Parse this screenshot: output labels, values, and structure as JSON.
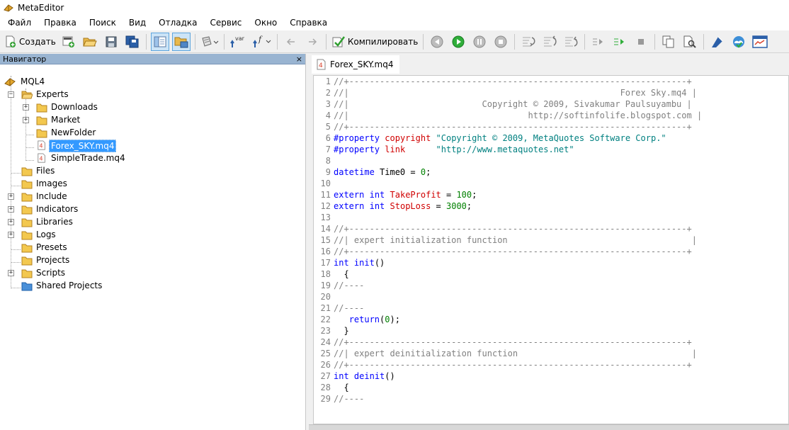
{
  "app": {
    "title": "MetaEditor"
  },
  "menu": [
    "Файл",
    "Правка",
    "Поиск",
    "Вид",
    "Отладка",
    "Сервис",
    "Окно",
    "Справка"
  ],
  "toolbar": {
    "create_label": "Создать",
    "compile_label": "Компилировать",
    "var_label": "var",
    "f_label": "f"
  },
  "navigator": {
    "title": "Навигатор",
    "close": "×",
    "root": "MQL4",
    "experts": "Experts",
    "downloads": "Downloads",
    "market": "Market",
    "newfolder": "NewFolder",
    "forex_sky": "Forex_SKY.mq4",
    "simpletrade": "SimpleTrade.mq4",
    "files": "Files",
    "images": "Images",
    "include": "Include",
    "indicators": "Indicators",
    "libraries": "Libraries",
    "logs": "Logs",
    "presets": "Presets",
    "projects": "Projects",
    "scripts": "Scripts",
    "shared_projects": "Shared Projects"
  },
  "editor": {
    "tab_label": "Forex_SKY.mq4",
    "lines": [
      [
        [
          "c-comment",
          "//+------------------------------------------------------------------+"
        ]
      ],
      [
        [
          "c-comment",
          "//|                                                     Forex Sky.mq4 |"
        ]
      ],
      [
        [
          "c-comment",
          "//|                          Copyright © 2009, Sivakumar Paulsuyambu |"
        ]
      ],
      [
        [
          "c-comment",
          "//|                                   http://softinfolife.blogspot.com |"
        ]
      ],
      [
        [
          "c-comment",
          "//+------------------------------------------------------------------+"
        ]
      ],
      [
        [
          "c-kw",
          "#property"
        ],
        [
          "",
          " "
        ],
        [
          "c-red",
          "copyright"
        ],
        [
          "",
          " "
        ],
        [
          "c-str",
          "\"Copyright © 2009, MetaQuotes Software Corp.\""
        ]
      ],
      [
        [
          "c-kw",
          "#property"
        ],
        [
          "",
          " "
        ],
        [
          "c-red",
          "link"
        ],
        [
          "",
          "      "
        ],
        [
          "c-str",
          "\"http://www.metaquotes.net\""
        ]
      ],
      [],
      [
        [
          "c-kw",
          "datetime"
        ],
        [
          "",
          " Time0 = "
        ],
        [
          "c-num",
          "0"
        ],
        [
          "",
          ";"
        ]
      ],
      [],
      [
        [
          "c-kw",
          "extern"
        ],
        [
          "",
          " "
        ],
        [
          "c-kw",
          "int"
        ],
        [
          "",
          " "
        ],
        [
          "c-red",
          "TakeProfit"
        ],
        [
          "",
          " = "
        ],
        [
          "c-num",
          "100"
        ],
        [
          "",
          ";"
        ]
      ],
      [
        [
          "c-kw",
          "extern"
        ],
        [
          "",
          " "
        ],
        [
          "c-kw",
          "int"
        ],
        [
          "",
          " "
        ],
        [
          "c-red",
          "StopLoss"
        ],
        [
          "",
          " = "
        ],
        [
          "c-num",
          "3000"
        ],
        [
          "",
          ";"
        ]
      ],
      [],
      [
        [
          "c-comment",
          "//+------------------------------------------------------------------+"
        ]
      ],
      [
        [
          "c-comment",
          "//| expert initialization function                                    |"
        ]
      ],
      [
        [
          "c-comment",
          "//+------------------------------------------------------------------+"
        ]
      ],
      [
        [
          "c-kw",
          "int"
        ],
        [
          "",
          " "
        ],
        [
          "c-kw",
          "init"
        ],
        [
          "",
          "()"
        ]
      ],
      [
        [
          "",
          "  {"
        ]
      ],
      [
        [
          "c-comment",
          "//----"
        ]
      ],
      [],
      [
        [
          "c-comment",
          "//----"
        ]
      ],
      [
        [
          "",
          "   "
        ],
        [
          "c-kw",
          "return"
        ],
        [
          "",
          "("
        ],
        [
          "c-num",
          "0"
        ],
        [
          "",
          ");"
        ]
      ],
      [
        [
          "",
          "  }"
        ]
      ],
      [
        [
          "c-comment",
          "//+------------------------------------------------------------------+"
        ]
      ],
      [
        [
          "c-comment",
          "//| expert deinitialization function                                  |"
        ]
      ],
      [
        [
          "c-comment",
          "//+------------------------------------------------------------------+"
        ]
      ],
      [
        [
          "c-kw",
          "int"
        ],
        [
          "",
          " "
        ],
        [
          "c-kw",
          "deinit"
        ],
        [
          "",
          "()"
        ]
      ],
      [
        [
          "",
          "  {"
        ]
      ],
      [
        [
          "c-comment",
          "//----"
        ]
      ]
    ]
  },
  "colors": {
    "accent": "#3399ff",
    "keyword": "#0000ff",
    "comment": "#808080",
    "string": "#008080",
    "number": "#008000"
  }
}
